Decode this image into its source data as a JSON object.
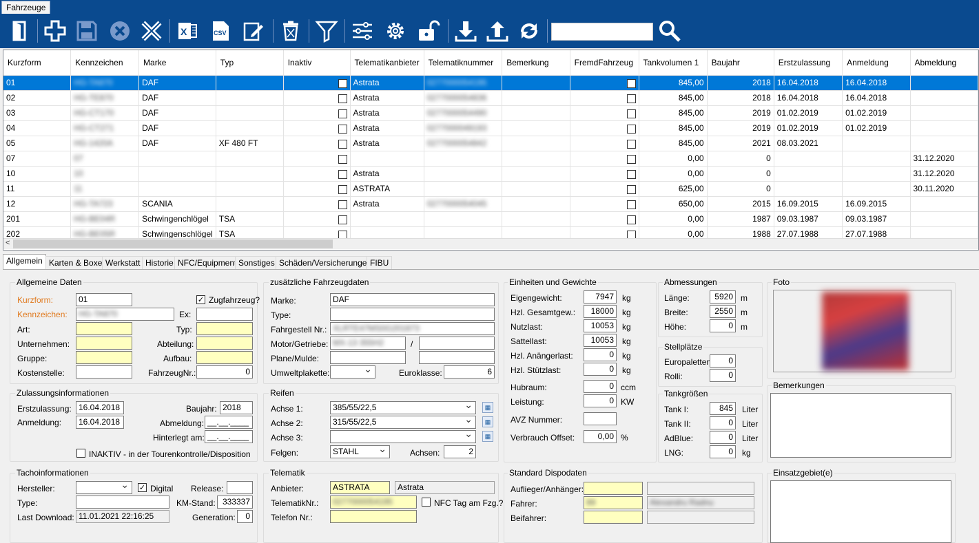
{
  "window": {
    "tab_label": "Fahrzeuge"
  },
  "toolbar": {
    "icons": [
      "exit-icon",
      "add-icon",
      "save-icon",
      "cancel-icon",
      "delete-x-icon",
      "excel-export-icon",
      "csv-export-icon",
      "edit-icon",
      "trash-icon",
      "filter-icon",
      "column-settings-icon",
      "settings-gear-icon",
      "unlock-icon",
      "download-icon",
      "upload-icon",
      "sync-icon",
      "search-icon"
    ],
    "search_value": ""
  },
  "grid": {
    "columns": [
      "Kurzform",
      "Kennzeichen",
      "Marke",
      "Typ",
      "Inaktiv",
      "Telematikanbieter",
      "Telematiknummer",
      "Bemerkung",
      "FremdFahrzeug",
      "Tankvolumen 1",
      "Baujahr",
      "Erstzulassung",
      "Anmeldung",
      "Abmeldung"
    ],
    "rows": [
      {
        "kurzform": "01",
        "kennzeichen": "HG-TA870",
        "marke": "DAF",
        "typ": "",
        "anbieter": "Astrata",
        "telnr": "0277000054195",
        "tank": "845,00",
        "baujahr": "2018",
        "erstzul": "16.04.2018",
        "anmeldung": "16.04.2018",
        "abmeldung": "",
        "selected": true
      },
      {
        "kurzform": "02",
        "kennzeichen": "HG-TE870",
        "marke": "DAF",
        "typ": "",
        "anbieter": "Astrata",
        "telnr": "0277000054836",
        "tank": "845,00",
        "baujahr": "2018",
        "erstzul": "16.04.2018",
        "anmeldung": "16.04.2018",
        "abmeldung": ""
      },
      {
        "kurzform": "03",
        "kennzeichen": "HG-CT170",
        "marke": "DAF",
        "typ": "",
        "anbieter": "Astrata",
        "telnr": "0277000054490",
        "tank": "845,00",
        "baujahr": "2019",
        "erstzul": "01.02.2019",
        "anmeldung": "01.02.2019",
        "abmeldung": ""
      },
      {
        "kurzform": "04",
        "kennzeichen": "HG-CT271",
        "marke": "DAF",
        "typ": "",
        "anbieter": "Astrata",
        "telnr": "0277000049193",
        "tank": "845,00",
        "baujahr": "2019",
        "erstzul": "01.02.2019",
        "anmeldung": "01.02.2019",
        "abmeldung": ""
      },
      {
        "kurzform": "05",
        "kennzeichen": "HG-1420A",
        "marke": "DAF",
        "typ": "XF 480 FT",
        "anbieter": "Astrata",
        "telnr": "0277000054842",
        "tank": "845,00",
        "baujahr": "2021",
        "erstzul": "08.03.2021",
        "anmeldung": "",
        "abmeldung": ""
      },
      {
        "kurzform": "07",
        "kennzeichen": "07",
        "marke": "",
        "typ": "",
        "anbieter": "",
        "telnr": "",
        "tank": "0,00",
        "baujahr": "0",
        "erstzul": "",
        "anmeldung": "",
        "abmeldung": "31.12.2020"
      },
      {
        "kurzform": "10",
        "kennzeichen": "10",
        "marke": "",
        "typ": "",
        "anbieter": "Astrata",
        "telnr": "",
        "tank": "0,00",
        "baujahr": "0",
        "erstzul": "",
        "anmeldung": "",
        "abmeldung": "31.12.2020"
      },
      {
        "kurzform": "11",
        "kennzeichen": "11",
        "marke": "",
        "typ": "",
        "anbieter": "ASTRATA",
        "telnr": "",
        "tank": "625,00",
        "baujahr": "0",
        "erstzul": "",
        "anmeldung": "",
        "abmeldung": "30.11.2020"
      },
      {
        "kurzform": "12",
        "kennzeichen": "HG-TA723",
        "marke": "SCANIA",
        "typ": "",
        "anbieter": "Astrata",
        "telnr": "0277000054045",
        "tank": "650,00",
        "baujahr": "2015",
        "erstzul": "16.09.2015",
        "anmeldung": "16.09.2015",
        "abmeldung": ""
      },
      {
        "kurzform": "201",
        "kennzeichen": "HG-BE04R",
        "marke": "Schwingenchlögel",
        "typ": "TSA",
        "anbieter": "",
        "telnr": "",
        "tank": "0,00",
        "baujahr": "1987",
        "erstzul": "09.03.1987",
        "anmeldung": "09.03.1987",
        "abmeldung": ""
      },
      {
        "kurzform": "202",
        "kennzeichen": "HG-BE05R",
        "marke": "Schwingenschlögel",
        "typ": "TSA",
        "anbieter": "",
        "telnr": "",
        "tank": "0,00",
        "baujahr": "1988",
        "erstzul": "27.07.1988",
        "anmeldung": "27.07.1988",
        "abmeldung": ""
      }
    ],
    "scroll_left": "<"
  },
  "tabs": [
    "Allgemein",
    "Karten & Boxen",
    "Werkstatt",
    "Historie",
    "NFC/Equipment",
    "Sonstiges",
    "Schäden/Versicherungen",
    "FIBU"
  ],
  "allgemeine_daten": {
    "title": "Allgemeine Daten",
    "kurzform_label": "Kurzform:",
    "kurzform": "01",
    "zugfahrzeug_label": "Zugfahrzeug?",
    "kennzeichen_label": "Kennzeichen:",
    "kennzeichen": "HG-TA870",
    "ex_label": "Ex:",
    "art_label": "Art:",
    "typ_label": "Typ:",
    "unternehmen_label": "Unternehmen:",
    "abteilung_label": "Abteilung:",
    "gruppe_label": "Gruppe:",
    "aufbau_label": "Aufbau:",
    "kostenstelle_label": "Kostenstelle:",
    "fahrzeugnr_label": "FahrzeugNr.:",
    "fahrzeugnr": "0"
  },
  "zusatz": {
    "title": "zusätzliche Fahrzeugdaten",
    "marke_label": "Marke:",
    "marke": "DAF",
    "type_label": "Type:",
    "fahrgestell_label": "Fahrgestell Nr.:",
    "fahrgestell": "XLRTE47MS0G201873",
    "motor_label": "Motor/Getriebe:",
    "motor": "MX-13 355H2",
    "slash": "/",
    "plane_label": "Plane/Mulde:",
    "umwelt_label": "Umweltplakette:",
    "euroklasse_label": "Euroklasse:",
    "euroklasse": "6"
  },
  "einheiten": {
    "title": "Einheiten und Gewichte",
    "rows": [
      {
        "label": "Eigengewicht:",
        "value": "7947",
        "unit": "kg"
      },
      {
        "label": "Hzl. Gesamtgew.:",
        "value": "18000",
        "unit": "kg"
      },
      {
        "label": "Nutzlast:",
        "value": "10053",
        "unit": "kg"
      },
      {
        "label": "Sattellast:",
        "value": "10053",
        "unit": "kg"
      },
      {
        "label": "Hzl. Anängerlast:",
        "value": "0",
        "unit": "kg"
      },
      {
        "label": "Hzl. Stützlast:",
        "value": "0",
        "unit": "kg"
      },
      {
        "label": "Hubraum:",
        "value": "0",
        "unit": "ccm"
      },
      {
        "label": "Leistung:",
        "value": "0",
        "unit": "KW"
      }
    ],
    "avz_label": "AVZ Nummer:",
    "verbrauch_label": "Verbrauch Offset:",
    "verbrauch": "0,00",
    "verbrauch_unit": "%"
  },
  "abmessungen": {
    "title": "Abmessungen",
    "rows": [
      {
        "label": "Länge:",
        "value": "5920",
        "unit": "m"
      },
      {
        "label": "Breite:",
        "value": "2550",
        "unit": "m"
      },
      {
        "label": "Höhe:",
        "value": "0",
        "unit": "m"
      }
    ]
  },
  "stellplaetze": {
    "title": "Stellplätze",
    "rows": [
      {
        "label": "Europaletten:",
        "value": "0"
      },
      {
        "label": "Rolli:",
        "value": "0"
      }
    ]
  },
  "tank": {
    "title": "Tankgrößen",
    "rows": [
      {
        "label": "Tank I:",
        "value": "845",
        "unit": "Liter"
      },
      {
        "label": "Tank II:",
        "value": "0",
        "unit": "Liter"
      },
      {
        "label": "AdBlue:",
        "value": "0",
        "unit": "Liter"
      },
      {
        "label": "LNG:",
        "value": "0",
        "unit": "kg"
      }
    ]
  },
  "foto": {
    "title": "Foto"
  },
  "bemerkungen": {
    "title": "Bemerkungen"
  },
  "einsatzgebiet": {
    "title": "Einsatzgebiet(e)"
  },
  "zulassung": {
    "title": "Zulassungsinformationen",
    "erstzulassung_label": "Erstzulassung:",
    "erstzulassung": "16.04.2018",
    "baujahr_label": "Baujahr:",
    "baujahr": "2018",
    "anmeldung_label": "Anmeldung:",
    "anmeldung": "16.04.2018",
    "abmeldung_label": "Abmeldung:",
    "abmeldung": "__.__.____",
    "hinterlegt_label": "Hinterlegt am:",
    "hinterlegt": "__.__.____",
    "inaktiv_label": "INAKTIV - in der Tourenkontrolle/Disposition"
  },
  "reifen": {
    "title": "Reifen",
    "achse1_label": "Achse 1:",
    "achse1": "385/55/22,5",
    "achse2_label": "Achse 2:",
    "achse2": "315/55/22,5",
    "achse3_label": "Achse 3:",
    "achse3": "",
    "felgen_label": "Felgen:",
    "felgen": "STAHL",
    "achsen_label": "Achsen:",
    "achsen": "2"
  },
  "tacho": {
    "title": "Tachoinformationen",
    "hersteller_label": "Hersteller:",
    "digital_label": "Digital",
    "release_label": "Release:",
    "type_label": "Type:",
    "kmstand_label": "KM-Stand:",
    "kmstand": "333337",
    "lastdl_label": "Last Download:",
    "lastdl": "11.01.2021 22:16:25",
    "generation_label": "Generation:",
    "generation": "0"
  },
  "telematik": {
    "title": "Telematik",
    "anbieter_label": "Anbieter:",
    "anbieter": "ASTRATA",
    "anbieter2": "Astrata",
    "telnr_label": "TelematikNr.:",
    "telnr": "0277000054195",
    "nfc_label": "NFC Tag am Fzg.?",
    "telefon_label": "Telefon Nr.:"
  },
  "dispo": {
    "title": "Standard Dispodaten",
    "auflieger_label": "Auflieger/Anhänger:",
    "fahrer_label": "Fahrer:",
    "fahrer": "89",
    "fahrer_name": "Alexandru Radnu",
    "beifahrer_label": "Beifahrer:"
  }
}
